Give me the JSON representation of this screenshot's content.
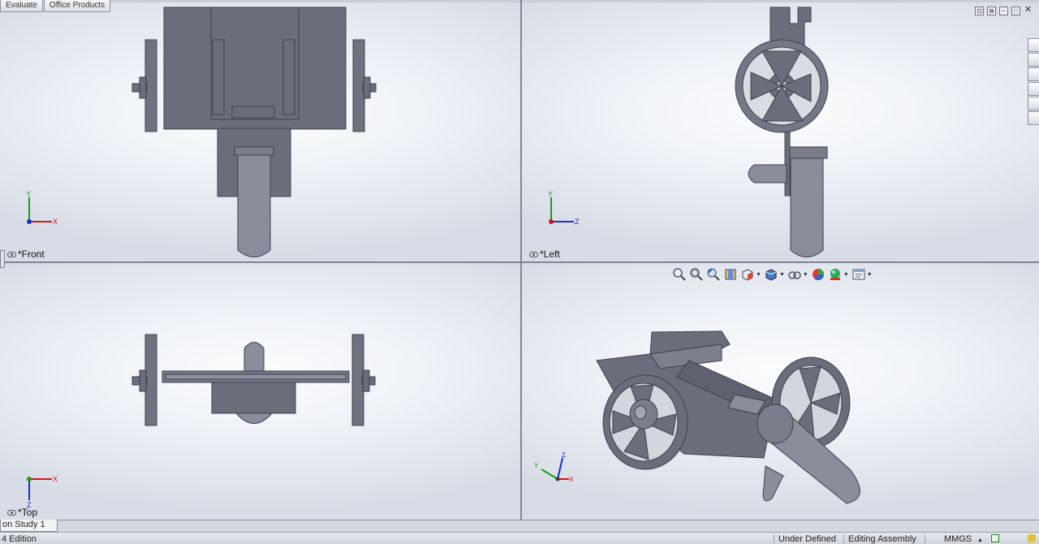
{
  "command_tabs": [
    "Evaluate",
    "Office Products"
  ],
  "viewports": {
    "front": {
      "label": "*Front"
    },
    "left": {
      "label": "*Left"
    },
    "top": {
      "label": "*Top"
    },
    "iso": {
      "label": ""
    }
  },
  "triad": {
    "front": {
      "a": "Y",
      "b": "X"
    },
    "left": {
      "a": "Y",
      "b": "Z"
    },
    "top": {
      "a": "X",
      "b": "Z"
    },
    "iso": {
      "a": "Y",
      "b": "Z",
      "c": "X"
    }
  },
  "window_controls": [
    "tile-icon",
    "restore-icon",
    "minimize-icon",
    "maximize-icon",
    "close-icon"
  ],
  "task_pane_icons": [
    "home-icon",
    "design-library-icon",
    "file-explorer-icon",
    "view-palette-icon",
    "appearances-icon",
    "custom-properties-icon"
  ],
  "heads_up_toolbar": [
    {
      "icon": "zoom-to-fit-icon",
      "dropdown": false
    },
    {
      "icon": "zoom-to-area-icon",
      "dropdown": false
    },
    {
      "icon": "previous-view-icon",
      "dropdown": false
    },
    {
      "icon": "section-view-icon",
      "dropdown": false
    },
    {
      "icon": "view-orientation-icon",
      "dropdown": true
    },
    {
      "icon": "display-style-icon",
      "dropdown": true
    },
    {
      "icon": "hide-show-items-icon",
      "dropdown": true
    },
    {
      "icon": "edit-appearance-icon",
      "dropdown": false
    },
    {
      "icon": "apply-scene-icon",
      "dropdown": true
    },
    {
      "icon": "view-settings-icon",
      "dropdown": true
    }
  ],
  "bottom_tab": {
    "label": "on Study 1"
  },
  "status_bar": {
    "left": "4 Edition",
    "definition": "Under Defined",
    "mode": "Editing Assembly",
    "units": "MMGS",
    "units_caret": "▲"
  },
  "colors": {
    "part": "#6a6d7c",
    "part_dark": "#50525f",
    "part_light": "#8c8fa0",
    "axis_x": "#d01818",
    "axis_y": "#1a9a1a",
    "axis_z": "#1a2bd0"
  }
}
